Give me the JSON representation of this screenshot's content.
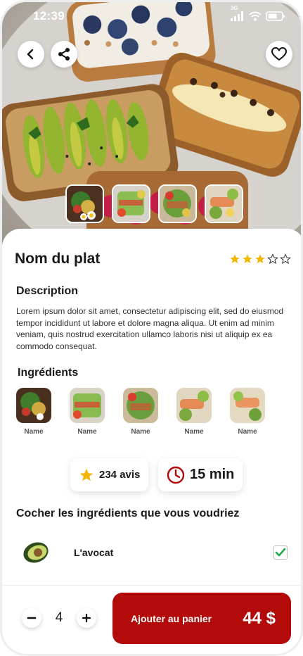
{
  "status_bar": {
    "time": "12:39",
    "network": "3G"
  },
  "header": {
    "back_icon": "chevron-left-icon",
    "share_icon": "share-icon",
    "favorite_icon": "heart-icon"
  },
  "dish": {
    "title": "Nom du plat",
    "rating": 3,
    "rating_max": 5
  },
  "description": {
    "heading": "Description",
    "text": "Lorem ipsum dolor sit amet, consectetur adipiscing elit, sed do eiusmod tempor incididunt ut labore et dolore magna aliqua. Ut enim ad minim veniam, quis nostrud exercitation ullamco laboris nisi ut aliquip ex ea commodo consequat."
  },
  "ingredients": {
    "heading": "Ingrédients",
    "items": [
      {
        "name": "Name"
      },
      {
        "name": "Name"
      },
      {
        "name": "Name"
      },
      {
        "name": "Name"
      },
      {
        "name": "Name"
      }
    ]
  },
  "stats": {
    "reviews": "234 avis",
    "time": "15 min"
  },
  "choices": {
    "heading": "Cocher les ingrédients que vous voudriez",
    "items": [
      {
        "label": "L'avocat",
        "checked": true
      }
    ]
  },
  "cart": {
    "quantity": "4",
    "button_label": "Ajouter au panier",
    "price": "44 $"
  },
  "colors": {
    "accent": "#b30a0a",
    "star": "#f5b400",
    "check": "#1faa4b"
  }
}
